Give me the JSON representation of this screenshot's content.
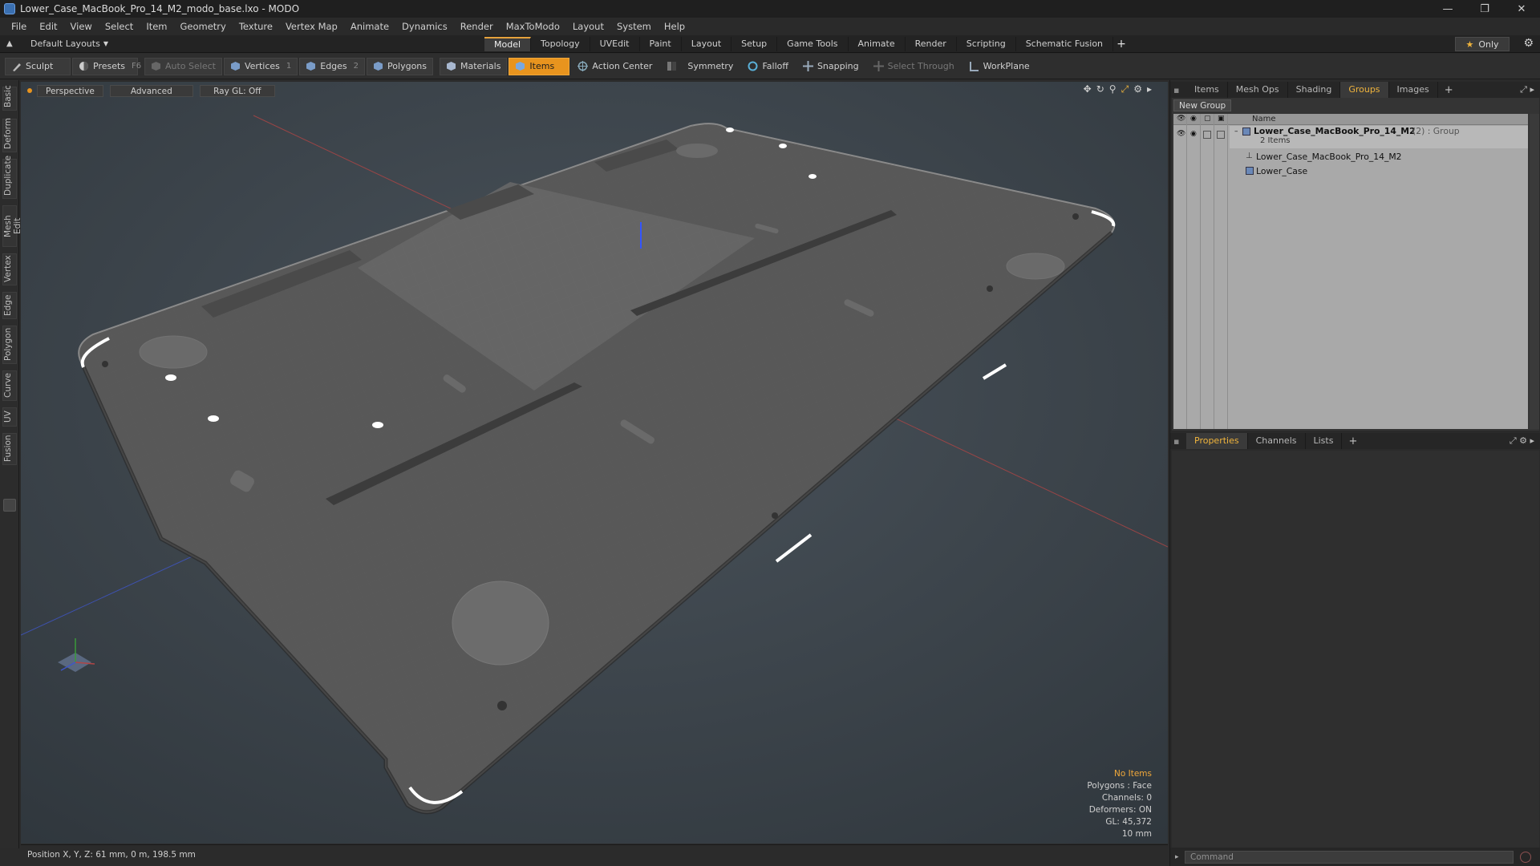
{
  "window": {
    "title": "Lower_Case_MacBook_Pro_14_M2_modo_base.lxo - MODO",
    "controls": [
      "—",
      "❐",
      "✕"
    ]
  },
  "menu": [
    "File",
    "Edit",
    "View",
    "Select",
    "Item",
    "Geometry",
    "Texture",
    "Vertex Map",
    "Animate",
    "Dynamics",
    "Render",
    "MaxToModo",
    "Layout",
    "System",
    "Help"
  ],
  "layout_bar": {
    "layout_select": "Default Layouts",
    "tabs": [
      "Model",
      "Topology",
      "UVEdit",
      "Paint",
      "Layout",
      "Setup",
      "Game Tools",
      "Animate",
      "Render",
      "Scripting",
      "Schematic Fusion"
    ],
    "active_tab": "Model",
    "only_label": "Only"
  },
  "toolbar": {
    "sculpt": "Sculpt",
    "presets": "Presets",
    "presets_key": "F6",
    "auto_select": "Auto Select",
    "vertices": "Vertices",
    "vertices_key": "1",
    "edges": "Edges",
    "edges_key": "2",
    "polygons": "Polygons",
    "materials": "Materials",
    "items": "Items",
    "action_center": "Action Center",
    "symmetry": "Symmetry",
    "falloff": "Falloff",
    "snapping": "Snapping",
    "select_through": "Select Through",
    "workplane": "WorkPlane"
  },
  "left_tabs": [
    "Basic",
    "Deform",
    "Duplicate",
    "Mesh Edit",
    "Vertex",
    "Edge",
    "Polygon",
    "Curve",
    "UV",
    "Fusion"
  ],
  "viewport": {
    "view": "Perspective",
    "shading": "Advanced",
    "raygl": "Ray GL: Off",
    "hud": {
      "selection": "No Items",
      "polygons": "Polygons : Face",
      "channels": "Channels: 0",
      "deformers": "Deformers: ON",
      "gl": "GL: 45,372",
      "grid": "10 mm"
    }
  },
  "status": {
    "position": "Position X, Y, Z:  61 mm, 0 m, 198.5 mm"
  },
  "right_panel": {
    "top_tabs": [
      "Items",
      "Mesh Ops",
      "Shading",
      "Groups",
      "Images"
    ],
    "top_active": "Groups",
    "new_group": "New Group",
    "col_name": "Name",
    "group_name": "Lower_Case_MacBook_Pro_14_M2",
    "group_suffix": "(2) : Group",
    "group_count": "2 Items",
    "children": [
      "Lower_Case_MacBook_Pro_14_M2",
      "Lower_Case"
    ],
    "bottom_tabs": [
      "Properties",
      "Channels",
      "Lists"
    ],
    "bottom_active": "Properties",
    "command_placeholder": "Command"
  },
  "colors": {
    "accent": "#e8941e",
    "active_tab_text": "#f0b43c",
    "hud_warning": "#f0a83a"
  }
}
